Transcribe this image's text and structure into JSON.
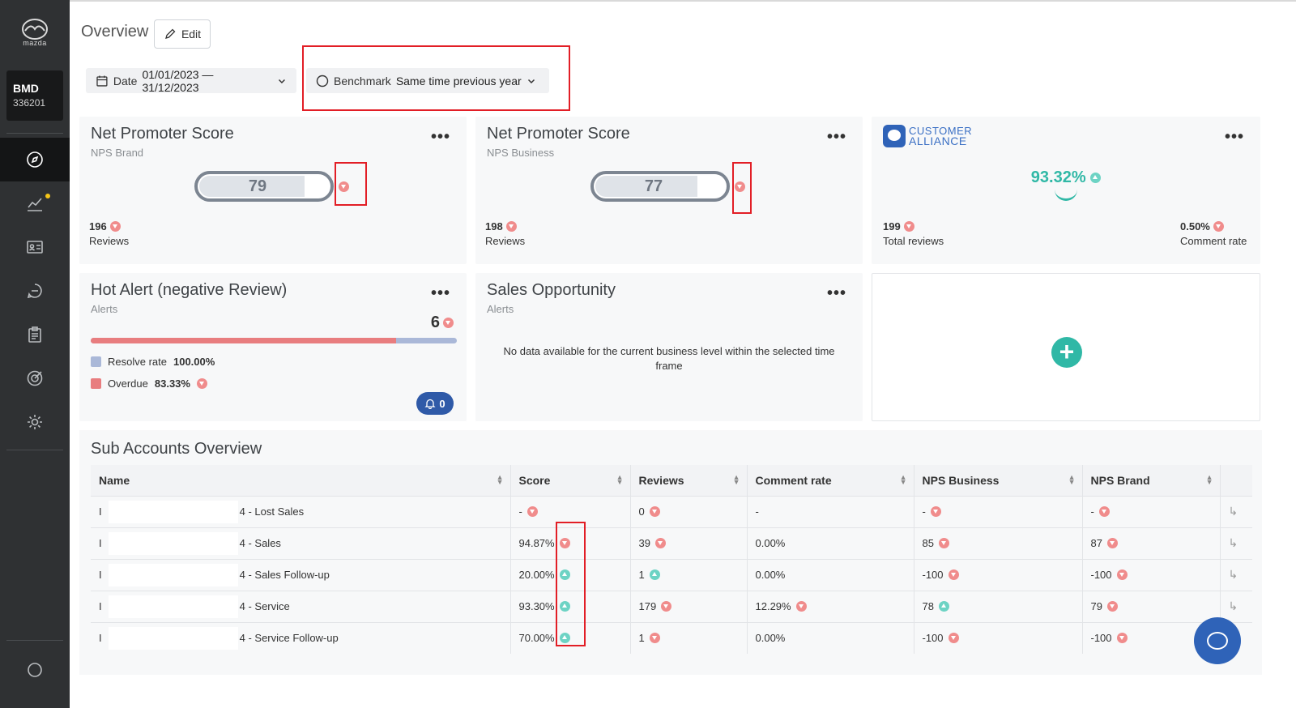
{
  "sidebar": {
    "logo_text": "mazda",
    "account_code": "BMD",
    "account_number": "336201"
  },
  "header": {
    "title": "Overview",
    "edit_label": "Edit"
  },
  "filters": {
    "date_label": "Date",
    "date_value": "01/01/2023 — 31/12/2023",
    "benchmark_label": "Benchmark",
    "benchmark_value": "Same time previous year"
  },
  "nps_brand": {
    "title": "Net Promoter Score",
    "subtitle": "NPS Brand",
    "score": "79",
    "score_value": 79,
    "reviews_count": "196",
    "reviews_label": "Reviews"
  },
  "nps_business": {
    "title": "Net Promoter Score",
    "subtitle": "NPS Business",
    "score": "77",
    "score_value": 77,
    "reviews_count": "198",
    "reviews_label": "Reviews"
  },
  "customer_alliance": {
    "logo_line1": "CUSTOMER",
    "logo_line2": "ALLIANCE",
    "percent": "93.32%",
    "total_reviews": "199",
    "total_reviews_label": "Total reviews",
    "comment_rate": "0.50%",
    "comment_rate_label": "Comment rate"
  },
  "hot_alert": {
    "title": "Hot Alert (negative Review)",
    "subtitle": "Alerts",
    "count": "6",
    "overdue_fraction": 0.8333,
    "resolve_label": "Resolve rate",
    "resolve_value": "100.00%",
    "overdue_label": "Overdue",
    "overdue_value": "83.33%",
    "bell_count": "0"
  },
  "sales_opportunity": {
    "title": "Sales Opportunity",
    "subtitle": "Alerts",
    "empty_message": "No data available for the current business level within the selected time frame"
  },
  "add_widget": {
    "label": "+"
  },
  "sub_accounts": {
    "title": "Sub Accounts Overview",
    "columns": [
      "Name",
      "Score",
      "Reviews",
      "Comment rate",
      "NPS Business",
      "NPS Brand"
    ],
    "rows": [
      {
        "name_prefix": "I",
        "name": "4 - Lost Sales",
        "score": "-",
        "score_trend": "down",
        "reviews": "0",
        "reviews_trend": "down",
        "comment_rate": "-",
        "comment_trend": "",
        "nps_business": "-",
        "nps_business_trend": "down",
        "nps_brand": "-",
        "nps_brand_trend": "down"
      },
      {
        "name_prefix": "I",
        "name": "4 - Sales",
        "score": "94.87%",
        "score_trend": "down",
        "reviews": "39",
        "reviews_trend": "down",
        "comment_rate": "0.00%",
        "comment_trend": "",
        "nps_business": "85",
        "nps_business_trend": "down",
        "nps_brand": "87",
        "nps_brand_trend": "down"
      },
      {
        "name_prefix": "I",
        "name": "4 - Sales Follow-up",
        "score": "20.00%",
        "score_trend": "up",
        "reviews": "1",
        "reviews_trend": "up",
        "comment_rate": "0.00%",
        "comment_trend": "",
        "nps_business": "-100",
        "nps_business_trend": "down",
        "nps_brand": "-100",
        "nps_brand_trend": "down"
      },
      {
        "name_prefix": "I",
        "name": "4 - Service",
        "score": "93.30%",
        "score_trend": "up",
        "reviews": "179",
        "reviews_trend": "down",
        "comment_rate": "12.29%",
        "comment_trend": "down",
        "nps_business": "78",
        "nps_business_trend": "up",
        "nps_brand": "79",
        "nps_brand_trend": "down"
      },
      {
        "name_prefix": "I",
        "name": "4 - Service Follow-up",
        "score": "70.00%",
        "score_trend": "up",
        "reviews": "1",
        "reviews_trend": "down",
        "comment_rate": "0.00%",
        "comment_trend": "",
        "nps_business": "-100",
        "nps_business_trend": "down",
        "nps_brand": "-100",
        "nps_brand_trend": "down"
      }
    ]
  },
  "colors": {
    "sidebar_bg": "#2f3133",
    "accent_teal": "#30b8a6",
    "down_red": "#f08c8c",
    "up_teal": "#6dd3c4",
    "annotation_red": "#e21e26",
    "brand_blue": "#2f63b8"
  }
}
